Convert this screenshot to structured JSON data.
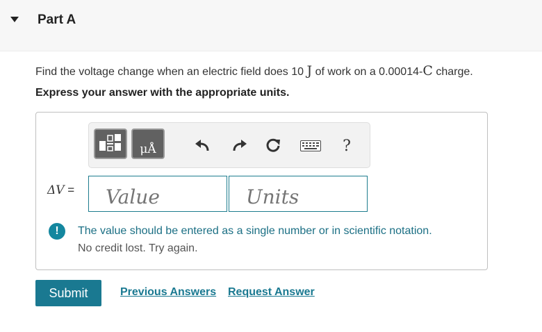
{
  "header": {
    "title": "Part A"
  },
  "question": {
    "prefix": "Find the voltage change when an electric field does 10",
    "work_unit": "J",
    "middle": "of work on a 0.00014-",
    "charge_unit": "C",
    "suffix": "charge."
  },
  "instruction": "Express your answer with the appropriate units.",
  "toolbar": {
    "units_button_label": "μÅ",
    "help_label": "?",
    "icons": [
      "templates-icon",
      "units-icon",
      "undo-icon",
      "redo-icon",
      "reset-icon",
      "keyboard-icon",
      "help-icon"
    ]
  },
  "answer": {
    "label_symbol": "ΔV",
    "label_eq": " =",
    "value_placeholder": "Value",
    "units_placeholder": "Units"
  },
  "feedback": {
    "icon": "!",
    "message": "The value should be entered as a single number or in scientific notation.",
    "sub": "No credit lost. Try again."
  },
  "actions": {
    "submit": "Submit",
    "previous_answers": "Previous Answers",
    "request_answer": "Request Answer"
  },
  "colors": {
    "accent": "#1a7991",
    "feedback_text": "#1b6f84",
    "toolbar_dark": "#616161"
  }
}
